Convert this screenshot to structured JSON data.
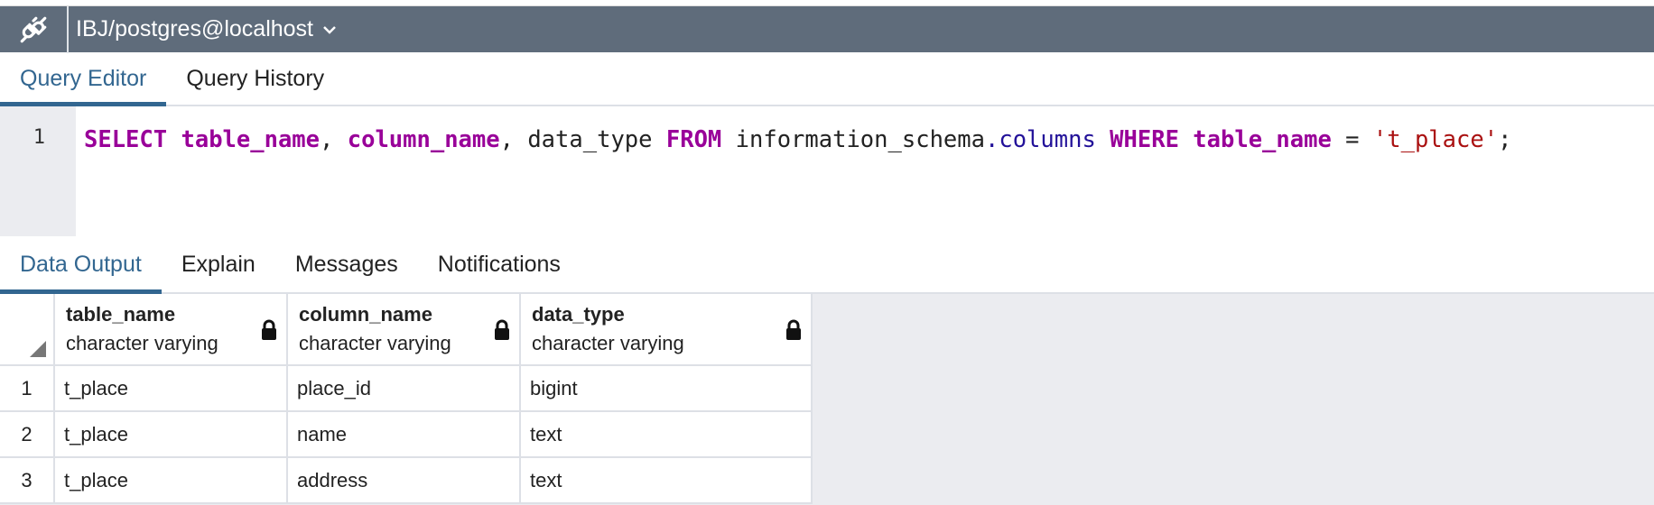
{
  "connection": {
    "label": "IBJ/postgres@localhost",
    "icon": "plug-icon"
  },
  "editor_tabs": [
    {
      "label": "Query Editor",
      "active": true
    },
    {
      "label": "Query History",
      "active": false
    }
  ],
  "editor": {
    "line_number": "1",
    "sql": {
      "t1": "SELECT",
      "t2": "table_name",
      "t3": ", ",
      "t4": "column_name",
      "t5": ", data_type ",
      "t6": "FROM",
      "t7": " information_schema",
      "t8": ".columns",
      "t9": " ",
      "t10": "WHERE",
      "t11": "table_name",
      "t12": " = ",
      "t13": "'t_place'",
      "t14": ";"
    }
  },
  "output_tabs": [
    {
      "label": "Data Output",
      "active": true
    },
    {
      "label": "Explain",
      "active": false
    },
    {
      "label": "Messages",
      "active": false
    },
    {
      "label": "Notifications",
      "active": false
    }
  ],
  "grid": {
    "columns": [
      {
        "name": "table_name",
        "type": "character varying"
      },
      {
        "name": "column_name",
        "type": "character varying"
      },
      {
        "name": "data_type",
        "type": "character varying"
      }
    ],
    "rows": [
      {
        "n": "1",
        "cells": [
          "t_place",
          "place_id",
          "bigint"
        ]
      },
      {
        "n": "2",
        "cells": [
          "t_place",
          "name",
          "text"
        ]
      },
      {
        "n": "3",
        "cells": [
          "t_place",
          "address",
          "text"
        ]
      }
    ]
  },
  "colors": {
    "accent": "#326690",
    "topbar": "#5f6c7b",
    "keyword": "#990099",
    "string": "#aa1111"
  }
}
